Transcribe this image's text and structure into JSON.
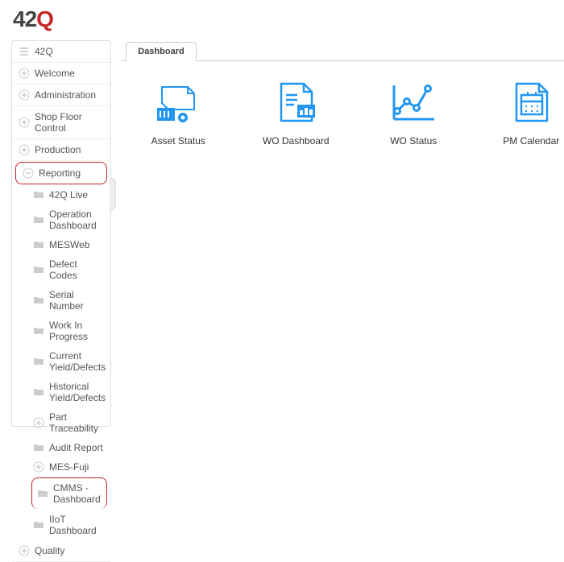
{
  "brand": {
    "part1": "42",
    "part2": "Q"
  },
  "sidebar": {
    "top_label": "42Q",
    "items": [
      {
        "label": "Welcome",
        "icon": "plus"
      },
      {
        "label": "Administration",
        "icon": "plus"
      },
      {
        "label": "Shop Floor Control",
        "icon": "plus"
      },
      {
        "label": "Production",
        "icon": "plus"
      }
    ],
    "reporting_label": "Reporting",
    "reporting_children": [
      {
        "label": "42Q Live",
        "icon": "folder"
      },
      {
        "label": "Operation Dashboard",
        "icon": "folder"
      },
      {
        "label": "MESWeb",
        "icon": "folder"
      },
      {
        "label": "Defect Codes",
        "icon": "folder"
      },
      {
        "label": "Serial Number",
        "icon": "folder"
      },
      {
        "label": "Work In Progress",
        "icon": "folder"
      },
      {
        "label": "Current Yield/Defects",
        "icon": "folder"
      },
      {
        "label": "Historical Yield/Defects",
        "icon": "folder"
      },
      {
        "label": "Part Traceability",
        "icon": "plus"
      },
      {
        "label": "Audit Report",
        "icon": "folder"
      },
      {
        "label": "MES-Fuji",
        "icon": "plus"
      },
      {
        "label": "CMMS - Dashboard",
        "icon": "folder",
        "highlight": true
      },
      {
        "label": "IIoT Dashboard",
        "icon": "folder"
      }
    ],
    "bottom_items": [
      {
        "label": "Quality",
        "icon": "plus"
      }
    ]
  },
  "tabs": {
    "active": "Dashboard"
  },
  "dashboard": {
    "tiles": [
      {
        "label": "Asset Status"
      },
      {
        "label": "WO Dashboard"
      },
      {
        "label": "WO Status"
      },
      {
        "label": "PM Calendar"
      }
    ]
  }
}
